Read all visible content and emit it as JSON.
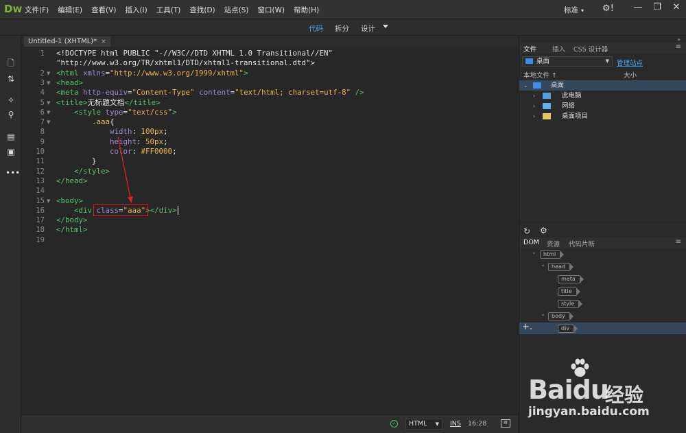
{
  "app": {
    "logo": "Dw",
    "menu": [
      "文件(F)",
      "编辑(E)",
      "查看(V)",
      "插入(I)",
      "工具(T)",
      "查找(D)",
      "站点(S)",
      "窗口(W)",
      "帮助(H)"
    ],
    "layout_label": "标准",
    "window_controls": {
      "minimize": "—",
      "restore": "❐",
      "close": "✕"
    }
  },
  "viewbar": {
    "code": "代码",
    "split": "拆分",
    "design": "设计",
    "active": "代码"
  },
  "document": {
    "tab_title": "Untitled-1 (XHTML)*",
    "tab_close": "×"
  },
  "editor": {
    "line_numbers": [
      "1",
      "2",
      "3",
      "4",
      "5",
      "6",
      "7",
      "8",
      "9",
      "10",
      "11",
      "12",
      "13",
      "14",
      "15",
      "16",
      "17",
      "18",
      "19"
    ],
    "lines": [
      {
        "n": "1",
        "fold": "",
        "segs": [
          [
            "txt",
            "<!DOCTYPE html PUBLIC \"-//W3C//DTD XHTML 1.0 Transitional//EN\""
          ]
        ]
      },
      {
        "n": "",
        "fold": "",
        "segs": [
          [
            "txt",
            "\"http://www.w3.org/TR/xhtml1/DTD/xhtml1-transitional.dtd\">"
          ]
        ]
      },
      {
        "n": "2",
        "fold": "▼",
        "segs": [
          [
            "tag",
            "<html "
          ],
          [
            "attr",
            "xmlns"
          ],
          [
            "txt",
            "="
          ],
          [
            "str",
            "\"http://www.w3.org/1999/xhtml\""
          ],
          [
            "tag",
            ">"
          ]
        ]
      },
      {
        "n": "3",
        "fold": "▼",
        "segs": [
          [
            "tag",
            "<head>"
          ]
        ]
      },
      {
        "n": "4",
        "fold": "",
        "segs": [
          [
            "tag",
            "<meta "
          ],
          [
            "attr",
            "http-equiv"
          ],
          [
            "txt",
            "="
          ],
          [
            "str",
            "\"Content-Type\""
          ],
          [
            "txt",
            " "
          ],
          [
            "attr",
            "content"
          ],
          [
            "txt",
            "="
          ],
          [
            "str",
            "\"text/html; charset=utf-8\""
          ],
          [
            "tag",
            " />"
          ]
        ]
      },
      {
        "n": "5",
        "fold": "▼",
        "segs": [
          [
            "tag",
            "<title>"
          ],
          [
            "txt",
            "无标题文档"
          ],
          [
            "tag",
            "</title>"
          ]
        ]
      },
      {
        "n": "6",
        "fold": "▼",
        "segs": [
          [
            "txt",
            "    "
          ],
          [
            "tag",
            "<style "
          ],
          [
            "attr",
            "type"
          ],
          [
            "txt",
            "="
          ],
          [
            "str",
            "\"text/css\""
          ],
          [
            "tag",
            ">"
          ]
        ]
      },
      {
        "n": "7",
        "fold": "▼",
        "segs": [
          [
            "txt",
            "        "
          ],
          [
            "sel",
            ".aaa"
          ],
          [
            "txt",
            "{"
          ]
        ]
      },
      {
        "n": "8",
        "fold": "",
        "segs": [
          [
            "txt",
            "            "
          ],
          [
            "prop",
            "width"
          ],
          [
            "txt",
            ": "
          ],
          [
            "val",
            "100px"
          ],
          [
            "txt",
            ";"
          ]
        ]
      },
      {
        "n": "9",
        "fold": "",
        "segs": [
          [
            "txt",
            "            "
          ],
          [
            "prop",
            "height"
          ],
          [
            "txt",
            ": "
          ],
          [
            "val",
            "50px"
          ],
          [
            "txt",
            ";"
          ]
        ]
      },
      {
        "n": "10",
        "fold": "",
        "segs": [
          [
            "txt",
            "            "
          ],
          [
            "prop",
            "color"
          ],
          [
            "txt",
            ": "
          ],
          [
            "val",
            "#FF0000"
          ],
          [
            "txt",
            ";"
          ]
        ]
      },
      {
        "n": "11",
        "fold": "",
        "segs": [
          [
            "txt",
            "        }"
          ]
        ]
      },
      {
        "n": "12",
        "fold": "",
        "segs": [
          [
            "txt",
            "    "
          ],
          [
            "tag",
            "</style>"
          ]
        ]
      },
      {
        "n": "13",
        "fold": "",
        "segs": [
          [
            "tag",
            "</head>"
          ]
        ]
      },
      {
        "n": "14",
        "fold": "",
        "segs": [
          [
            "txt",
            ""
          ]
        ]
      },
      {
        "n": "15",
        "fold": "▼",
        "segs": [
          [
            "tag",
            "<body>"
          ]
        ]
      },
      {
        "n": "16",
        "fold": "",
        "segs": [
          [
            "txt",
            "    "
          ],
          [
            "tag",
            "<div "
          ],
          [
            "attr",
            "class"
          ],
          [
            "txt",
            "="
          ],
          [
            "str",
            "\"aaa\""
          ],
          [
            "tag",
            "></div>"
          ]
        ]
      },
      {
        "n": "17",
        "fold": "",
        "segs": [
          [
            "tag",
            "</body>"
          ]
        ]
      },
      {
        "n": "18",
        "fold": "",
        "segs": [
          [
            "tag",
            "</html>"
          ]
        ]
      },
      {
        "n": "19",
        "fold": "",
        "segs": [
          [
            "txt",
            ""
          ]
        ]
      }
    ]
  },
  "status": {
    "language": "HTML",
    "ins": "INS",
    "position": "16:28"
  },
  "files_panel": {
    "tabs": [
      "文件",
      "插入",
      "CSS 设计器"
    ],
    "site": "桌面",
    "manage_site": "管理站点",
    "col_local": "本地文件 ↑",
    "col_size": "大小",
    "tree": [
      {
        "label": "桌面",
        "level": 0,
        "expanded": true,
        "icon": "desktop-icon",
        "selected": true
      },
      {
        "label": "此电脑",
        "level": 1,
        "expanded": false,
        "icon": "computer-icon",
        "selected": false
      },
      {
        "label": "网络",
        "level": 1,
        "expanded": false,
        "icon": "network-icon",
        "selected": false
      },
      {
        "label": "桌面项目",
        "level": 1,
        "expanded": false,
        "icon": "folder-icon",
        "selected": false
      }
    ]
  },
  "dom_panel": {
    "tabs": [
      "DOM",
      "资源",
      "代码片断"
    ],
    "nodes": [
      "html",
      "head",
      "meta",
      "title",
      "style",
      "body",
      "div"
    ]
  },
  "watermark": {
    "brand": "Baidu",
    "cn": "经验",
    "url": "jingyan.baidu.com"
  },
  "colors": {
    "accent": "#4fa3e8",
    "annotation": "#e02020",
    "logo": "#7fb53a"
  }
}
